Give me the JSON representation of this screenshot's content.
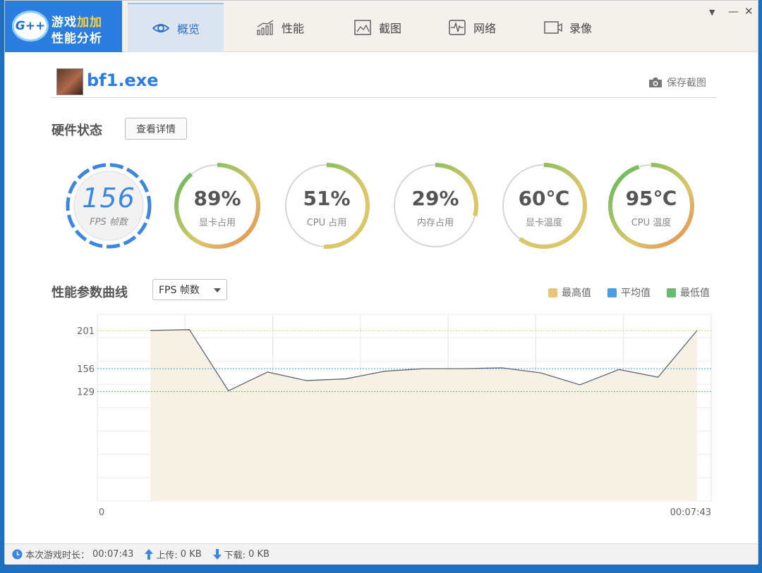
{
  "app": {
    "logo_badge": "G++",
    "logo_line1_a": "游戏",
    "logo_line1_b": "加加",
    "logo_line2": "性能分析"
  },
  "tabs": [
    {
      "label": "概览",
      "icon": "eye-icon",
      "active": true
    },
    {
      "label": "性能",
      "icon": "bar-chart-icon",
      "active": false
    },
    {
      "label": "截图",
      "icon": "image-icon",
      "active": false
    },
    {
      "label": "网络",
      "icon": "pulse-icon",
      "active": false
    },
    {
      "label": "录像",
      "icon": "video-camera-icon",
      "active": false
    }
  ],
  "window_controls": {
    "menu": "▼",
    "minimize": "—",
    "close": "✕"
  },
  "game": {
    "name": "bf1.exe",
    "save_screenshot_label": "保存截图"
  },
  "hardware": {
    "title": "硬件状态",
    "details_button": "查看详情",
    "fps": {
      "value": "156",
      "label": "FPS 帧数"
    },
    "gauges": [
      {
        "value": "89%",
        "label": "显卡占用",
        "fraction": 0.89
      },
      {
        "value": "51%",
        "label": "CPU 占用",
        "fraction": 0.51
      },
      {
        "value": "29%",
        "label": "内存占用",
        "fraction": 0.29
      },
      {
        "value": "60℃",
        "label": "显卡温度",
        "fraction": 0.6
      },
      {
        "value": "95℃",
        "label": "CPU 温度",
        "fraction": 0.95
      }
    ]
  },
  "curve": {
    "title": "性能参数曲线",
    "selected_metric": "FPS 帧数",
    "legend": [
      {
        "label": "最高值",
        "color": "#e8c673"
      },
      {
        "label": "平均值",
        "color": "#4a9be8"
      },
      {
        "label": "最低值",
        "color": "#6ab96e"
      }
    ]
  },
  "chart_data": {
    "type": "area",
    "x_start_label": "0",
    "x_end_label": "00:07:43",
    "y_ticks": [
      201,
      156,
      129
    ],
    "ylim": [
      0,
      220
    ],
    "max_value": 201,
    "avg_value": 156,
    "min_value": 129,
    "grid": true,
    "values": [
      201,
      202,
      130,
      152,
      142,
      144,
      153,
      156,
      156,
      157,
      151,
      137,
      155,
      146,
      201
    ]
  },
  "status": {
    "duration_label": "本次游戏时长：",
    "duration_value": "00:07:43",
    "upload_label": "上传:",
    "upload_value": "0 KB",
    "download_label": "下载:",
    "download_value": "0 KB"
  },
  "colors": {
    "accent": "#2b7de0",
    "gauge_green": "#5cb85c",
    "gauge_yellow": "#d9c76a",
    "gauge_orange": "#e88a50"
  }
}
